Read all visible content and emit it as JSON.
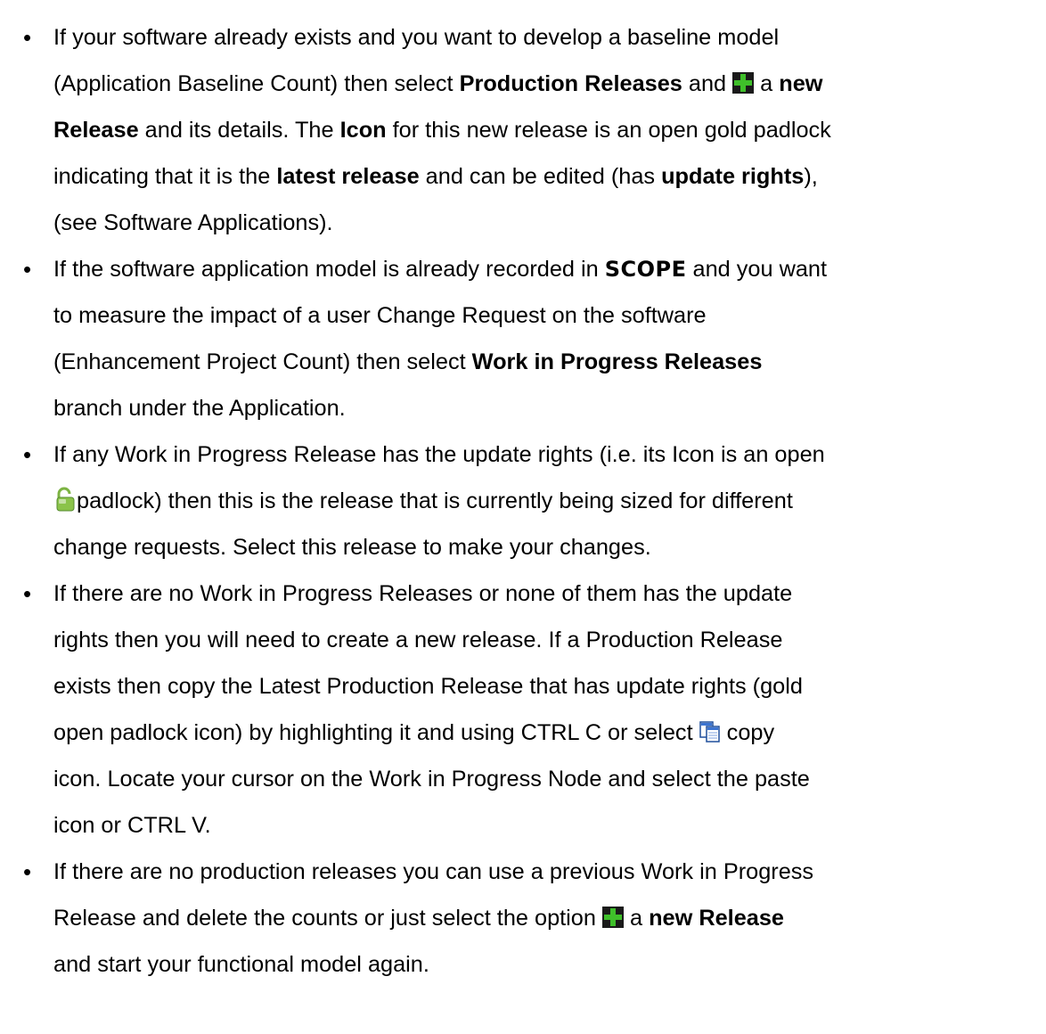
{
  "bullets": [
    {
      "lines": [
        {
          "segments": [
            {
              "t": "text",
              "v": "If your software already exists and you want to develop a baseline model"
            }
          ]
        },
        {
          "segments": [
            {
              "t": "text",
              "v": "(Application Baseline Count) then select "
            },
            {
              "t": "bold",
              "v": "Production Releases"
            },
            {
              "t": "text",
              "v": " and "
            },
            {
              "t": "icon",
              "icon": "add-icon"
            },
            {
              "t": "text",
              "v": " a "
            },
            {
              "t": "bold",
              "v": "new"
            }
          ]
        },
        {
          "segments": [
            {
              "t": "bold",
              "v": "Release"
            },
            {
              "t": "text",
              "v": " and its details. The "
            },
            {
              "t": "bold",
              "v": "Icon"
            },
            {
              "t": "text",
              "v": " for this new release is an open gold padlock"
            }
          ]
        },
        {
          "segments": [
            {
              "t": "text",
              "v": "indicating that it is the "
            },
            {
              "t": "bold",
              "v": "latest release"
            },
            {
              "t": "text",
              "v": " and can be edited (has "
            },
            {
              "t": "bold",
              "v": "update rights"
            },
            {
              "t": "text",
              "v": "),"
            }
          ]
        },
        {
          "segments": [
            {
              "t": "text",
              "v": "(see Software Applications)."
            }
          ]
        }
      ]
    },
    {
      "lines": [
        {
          "segments": [
            {
              "t": "text",
              "v": "If the software application model is already recorded in "
            },
            {
              "t": "scope",
              "v": "SCOPE"
            },
            {
              "t": "text",
              "v": " and you want"
            }
          ]
        },
        {
          "segments": [
            {
              "t": "text",
              "v": "to measure the impact of a user Change Request on the software"
            }
          ]
        },
        {
          "segments": [
            {
              "t": "text",
              "v": "(Enhancement Project Count) then select "
            },
            {
              "t": "bold",
              "v": "Work in Progress Releases"
            }
          ]
        },
        {
          "segments": [
            {
              "t": "text",
              "v": "branch under the Application."
            }
          ]
        }
      ]
    },
    {
      "lines": [
        {
          "segments": [
            {
              "t": "text",
              "v": "If any Work in Progress Release has the update rights (i.e. its Icon is an open"
            }
          ]
        },
        {
          "segments": [
            {
              "t": "icon",
              "icon": "padlock-icon"
            },
            {
              "t": "text",
              "v": "padlock) then this is the release that is currently being sized for different"
            }
          ]
        },
        {
          "segments": [
            {
              "t": "text",
              "v": "change requests.  Select this release to make your changes."
            }
          ]
        }
      ]
    },
    {
      "lines": [
        {
          "segments": [
            {
              "t": "text",
              "v": "If there are no Work in Progress Releases or none of them has the update"
            }
          ]
        },
        {
          "segments": [
            {
              "t": "text",
              "v": "rights then you will need to create a new release.  If a Production Release"
            }
          ]
        },
        {
          "segments": [
            {
              "t": "text",
              "v": "exists then copy the Latest Production Release that has update rights (gold"
            }
          ]
        },
        {
          "segments": [
            {
              "t": "text",
              "v": "open padlock icon) by highlighting it and using CTRL C or select "
            },
            {
              "t": "icon",
              "icon": "copy-icon"
            },
            {
              "t": "text",
              "v": "  copy"
            }
          ]
        },
        {
          "segments": [
            {
              "t": "text",
              "v": "icon.  Locate your cursor on the Work in Progress Node and select the paste"
            }
          ]
        },
        {
          "segments": [
            {
              "t": "text",
              "v": "icon or CTRL V."
            }
          ]
        }
      ]
    },
    {
      "lines": [
        {
          "segments": [
            {
              "t": "text",
              "v": " If there are no production releases you can use a previous Work in Progress"
            }
          ]
        },
        {
          "segments": [
            {
              "t": "text",
              "v": "Release and delete the counts or  just select the option "
            },
            {
              "t": "icon",
              "icon": "add-icon"
            },
            {
              "t": "text",
              "v": " a "
            },
            {
              "t": "bold",
              "v": "new Release"
            }
          ]
        },
        {
          "segments": [
            {
              "t": "text",
              "v": "and start your functional model again."
            }
          ]
        }
      ]
    }
  ]
}
